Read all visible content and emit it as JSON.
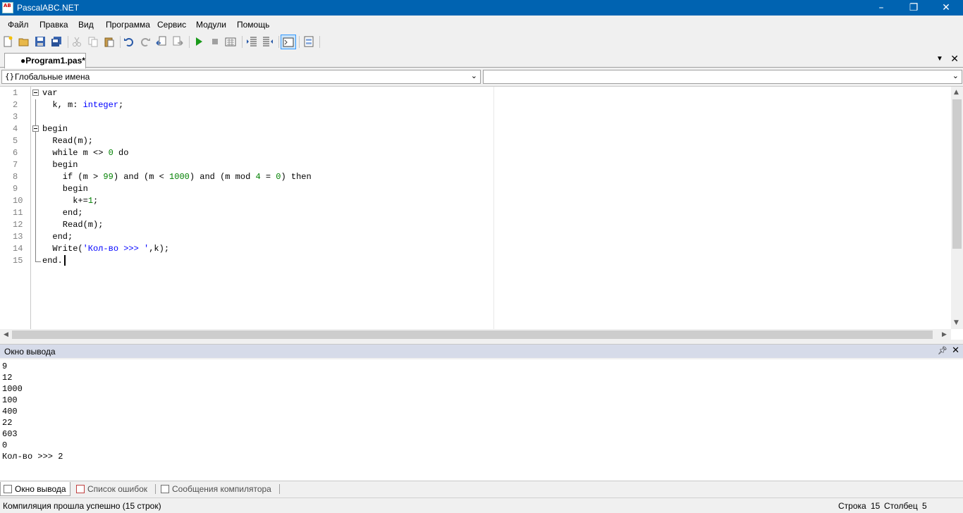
{
  "window": {
    "title": "PascalABC.NET",
    "icon_text": "AB"
  },
  "menu": [
    "Файл",
    "Правка",
    "Вид",
    "Программа",
    "Сервис",
    "Модули",
    "Помощь"
  ],
  "toolbar_icons": [
    "new-file-icon",
    "open-file-icon",
    "save-icon",
    "save-all-icon",
    "cut-icon",
    "copy-icon",
    "paste-icon",
    "undo-icon",
    "redo-icon",
    "navigate-back-icon",
    "navigate-forward-icon",
    "run-icon",
    "stop-icon",
    "compile-icon",
    "indent-icon",
    "outdent-icon",
    "output-window-icon",
    "form-designer-icon"
  ],
  "tab": {
    "label": "●Program1.pas*"
  },
  "combo": {
    "left_label": "Глобальные имена",
    "right_label": ""
  },
  "code": {
    "line_numbers": [
      "1",
      "2",
      "3",
      "4",
      "5",
      "6",
      "7",
      "8",
      "9",
      "10",
      "11",
      "12",
      "13",
      "14",
      "15"
    ],
    "lines": [
      [
        {
          "t": "var",
          "c": "kw"
        }
      ],
      [
        {
          "t": "  k, m: ",
          "c": ""
        },
        {
          "t": "integer",
          "c": "ty"
        },
        {
          "t": ";",
          "c": ""
        }
      ],
      [],
      [
        {
          "t": "begin",
          "c": "kw"
        }
      ],
      [
        {
          "t": "  Read(m);",
          "c": ""
        }
      ],
      [
        {
          "t": "  while m <> ",
          "c": ""
        },
        {
          "t": "0",
          "c": "nu"
        },
        {
          "t": " do",
          "c": ""
        }
      ],
      [
        {
          "t": "  begin",
          "c": ""
        }
      ],
      [
        {
          "t": "    if (m > ",
          "c": ""
        },
        {
          "t": "99",
          "c": "nu"
        },
        {
          "t": ") and (m < ",
          "c": ""
        },
        {
          "t": "1000",
          "c": "nu"
        },
        {
          "t": ") and (m mod ",
          "c": ""
        },
        {
          "t": "4",
          "c": "nu"
        },
        {
          "t": " = ",
          "c": ""
        },
        {
          "t": "0",
          "c": "nu"
        },
        {
          "t": ") then",
          "c": ""
        }
      ],
      [
        {
          "t": "    begin",
          "c": ""
        }
      ],
      [
        {
          "t": "      k+=",
          "c": ""
        },
        {
          "t": "1",
          "c": "nu"
        },
        {
          "t": ";",
          "c": ""
        }
      ],
      [
        {
          "t": "    end;",
          "c": ""
        }
      ],
      [
        {
          "t": "    Read(m);",
          "c": ""
        }
      ],
      [
        {
          "t": "  end;",
          "c": ""
        }
      ],
      [
        {
          "t": "  Write(",
          "c": ""
        },
        {
          "t": "'Кол-во >>> '",
          "c": "st"
        },
        {
          "t": ",k);",
          "c": ""
        }
      ],
      [
        {
          "t": "end.",
          "c": ""
        }
      ]
    ]
  },
  "output": {
    "title": "Окно вывода",
    "lines": [
      "9",
      "12",
      "1000",
      "100",
      "400",
      "22",
      "603",
      "0",
      "Кол-во >>> 2"
    ]
  },
  "bottom_tabs": [
    "Окно вывода",
    "Список ошибок",
    "Сообщения компилятора"
  ],
  "status": {
    "message": "Компиляция прошла успешно (15 строк)",
    "row_label": "Строка",
    "row_value": "15",
    "col_label": "Столбец",
    "col_value": "5"
  }
}
